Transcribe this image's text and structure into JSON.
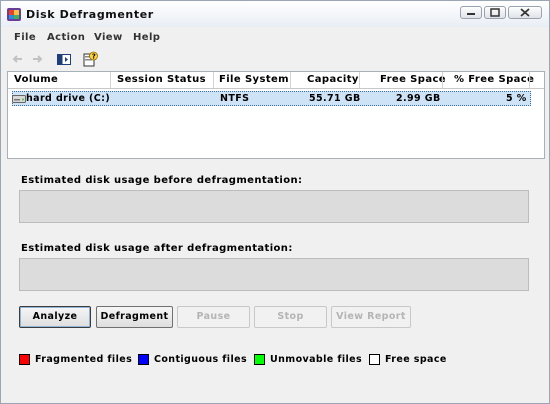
{
  "window": {
    "title": "Disk Defragmenter"
  },
  "menu": {
    "items": [
      "File",
      "Action",
      "View",
      "Help"
    ]
  },
  "toolbar": {
    "buttons": [
      "back-arrow-icon",
      "forward-arrow-icon",
      "show-hide-console-tree-icon",
      "help-icon"
    ]
  },
  "volumes": {
    "columns": [
      "Volume",
      "Session Status",
      "File System",
      "Capacity",
      "Free Space",
      "% Free Space"
    ],
    "rows": [
      {
        "volume": "hard drive (C:)",
        "session_status": "",
        "file_system": "NTFS",
        "capacity": "55.71 GB",
        "free_space": "2.99 GB",
        "percent_free": "5 %"
      }
    ]
  },
  "usage": {
    "before_label": "Estimated disk usage before defragmentation:",
    "after_label": "Estimated disk usage after defragmentation:"
  },
  "actions": {
    "analyze": "Analyze",
    "defragment": "Defragment",
    "pause": "Pause",
    "stop": "Stop",
    "view_report": "View Report"
  },
  "legend": [
    {
      "label": "Fragmented files",
      "color": "#ff0000"
    },
    {
      "label": "Contiguous files",
      "color": "#0000ff"
    },
    {
      "label": "Unmovable files",
      "color": "#00ff00"
    },
    {
      "label": "Free space",
      "color": "#ffffff"
    }
  ]
}
